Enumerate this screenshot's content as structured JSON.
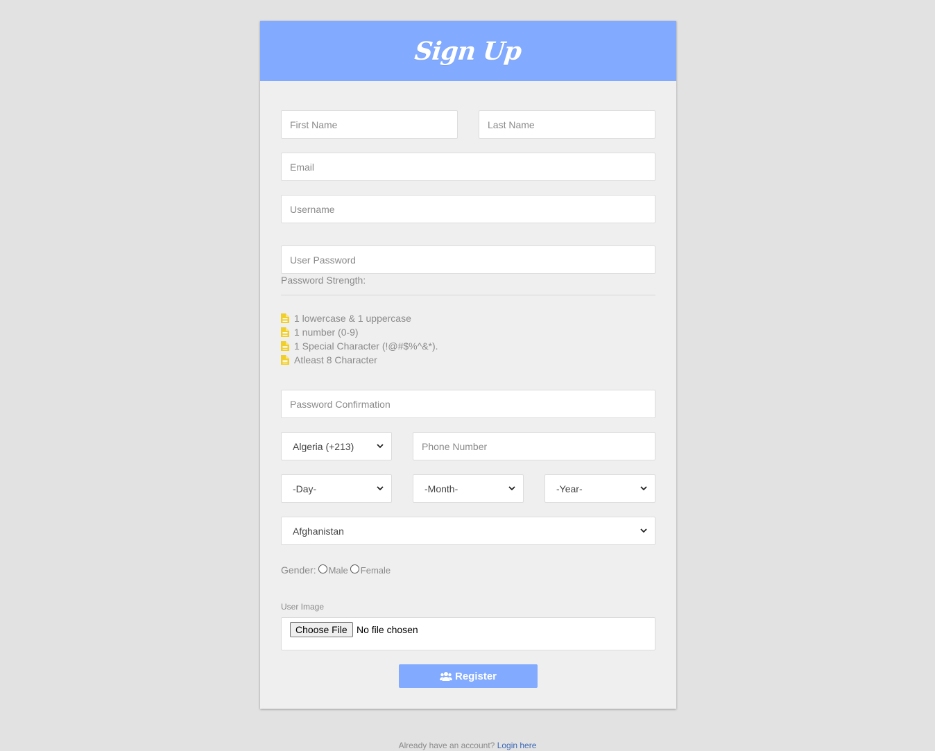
{
  "header": {
    "title": "Sign Up"
  },
  "form": {
    "first_name_placeholder": "First Name",
    "last_name_placeholder": "Last Name",
    "email_placeholder": "Email",
    "username_placeholder": "Username",
    "password_placeholder": "User Password",
    "password_strength_label": "Password Strength:",
    "password_rules": [
      "1 lowercase & 1 uppercase",
      "1 number (0-9)",
      "1 Special Character (!@#$%^&*).",
      "Atleast 8 Character"
    ],
    "password_confirm_placeholder": "Password Confirmation",
    "country_code": "Algeria (+213)",
    "phone_placeholder": "Phone Number",
    "day": "-Day-",
    "month": "-Month-",
    "year": "-Year-",
    "country": "Afghanistan",
    "gender_label": "Gender:",
    "gender_male": "Male",
    "gender_female": "Female",
    "user_image_label": "User Image",
    "choose_file_label": "Choose File",
    "file_status": "No file chosen",
    "register_label": "Register"
  },
  "footer": {
    "prompt": "Already have an account?",
    "login_link": "Login here"
  },
  "colors": {
    "accent": "#82aafe",
    "background": "#e2e2e2",
    "card": "#efefef",
    "rule_icon": "#f1cf2b"
  },
  "icons": {
    "rule": "file-text-icon",
    "register": "users-icon",
    "select": "chevron-down-icon"
  }
}
